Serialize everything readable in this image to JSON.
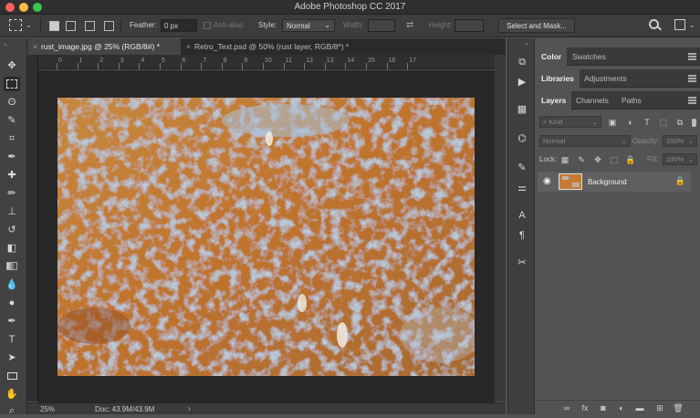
{
  "app": {
    "title": "Adobe Photoshop CC 2017",
    "accent_close": "#fc605c",
    "accent_min": "#fdbc40",
    "accent_max": "#34c84a"
  },
  "options_bar": {
    "feather_label": "Feather:",
    "feather_value": "0 px",
    "anti_alias_label": "Anti-alias",
    "style_label": "Style:",
    "style_value": "Normal",
    "width_label": "Width:",
    "height_label": "Height:",
    "select_and_mask_label": "Select and Mask..."
  },
  "document_tabs": [
    {
      "label": "rust_image.jpg @ 25% (RGB/8#) *",
      "close": "×"
    },
    {
      "label": "Retro_Text.psd @ 50% (rust layer, RGB/8*) *",
      "close": "×"
    }
  ],
  "ruler": {
    "ticks": [
      "0",
      "1",
      "2",
      "3",
      "4",
      "5",
      "6",
      "7",
      "8",
      "9",
      "10",
      "11",
      "12",
      "13",
      "14",
      "15",
      "16",
      "17"
    ]
  },
  "status_bar": {
    "zoom": "25%",
    "doc_info": "Doc: 43.9M/43.9M",
    "arrow": "›"
  },
  "panels": {
    "top_tabs": [
      "Color",
      "Swatches"
    ],
    "middle_tabs": [
      "Libraries",
      "Adjustments"
    ],
    "layer_tabs": [
      "Layers",
      "Channels",
      "Paths"
    ],
    "kind_label": "Kind",
    "blend_mode": "Normal",
    "opacity_label": "Opacity:",
    "opacity_value": "100%",
    "lock_label": "Lock:",
    "fill_label": "Fill:",
    "fill_value": "100%",
    "layers": [
      {
        "name": "Background",
        "visible": true,
        "locked": true
      }
    ]
  },
  "icons": {
    "eye": "eye-icon",
    "lock": "lock-icon",
    "search": "search-icon"
  }
}
